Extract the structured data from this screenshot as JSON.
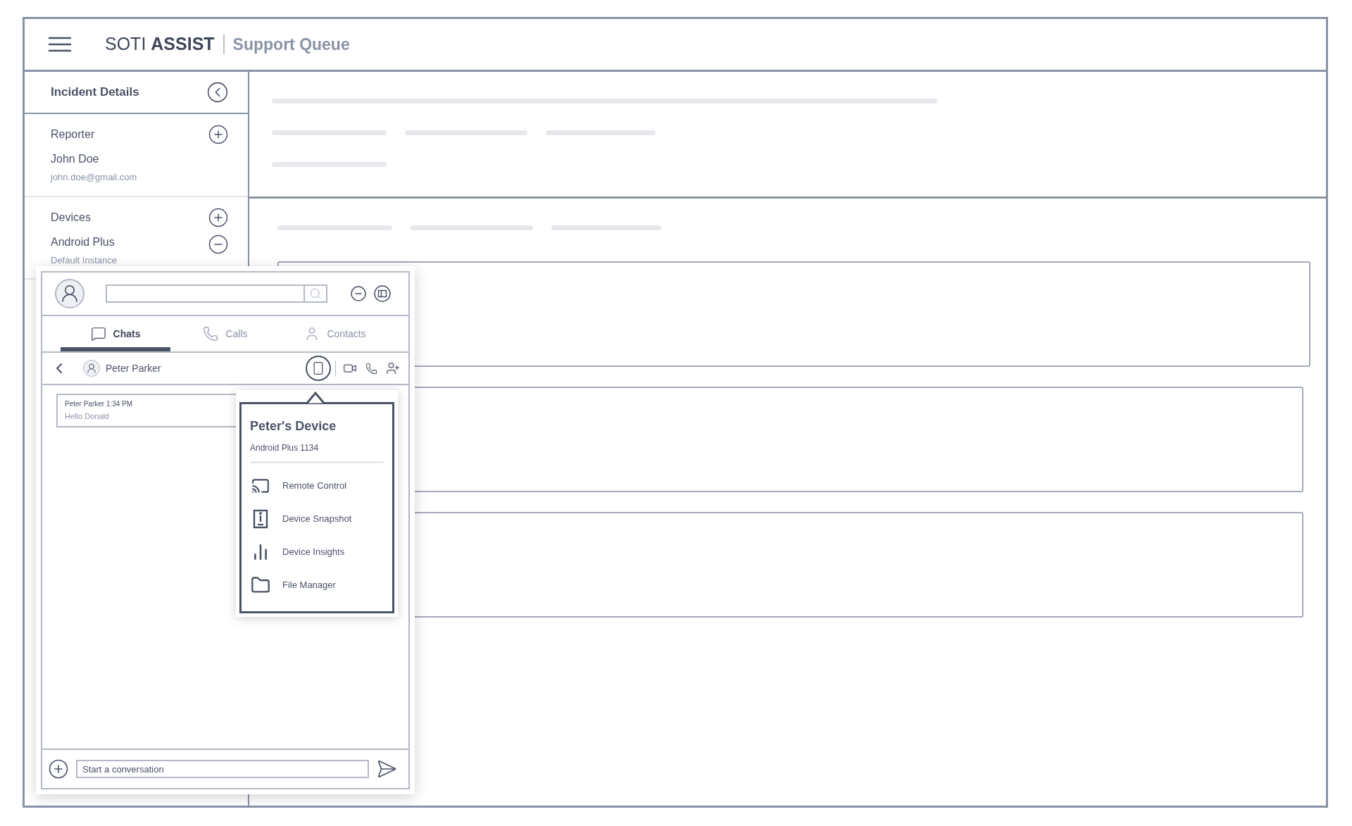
{
  "header": {
    "brand_light": "SOTI",
    "brand_bold": "ASSIST",
    "page_title": "Support Queue"
  },
  "sidebar": {
    "title": "Incident Details",
    "sections": [
      {
        "heading": "Reporter",
        "items": [
          {
            "title": "John Doe",
            "subtitle": "john.doe@gmail.com",
            "kind": "plain"
          }
        ]
      },
      {
        "heading": "Devices",
        "items": [
          {
            "title": "Android Plus",
            "subtitle": "Default Instance",
            "kind": "removable"
          }
        ]
      }
    ]
  },
  "chat": {
    "tabs": [
      {
        "label": "Chats",
        "kind": "chats",
        "selected": true
      },
      {
        "label": "Calls",
        "kind": "calls",
        "selected": false
      },
      {
        "label": "Contacts",
        "kind": "contacts",
        "selected": false
      }
    ],
    "contact": "Peter Parker",
    "messages": [
      {
        "meta": "Peter Parker 1:34 PM",
        "text": "Hello Donald"
      }
    ],
    "composer": {
      "placeholder": "Start a conversation"
    },
    "device_menu": {
      "title": "Peter's Device",
      "subtitle": "Android Plus 1134",
      "items": [
        {
          "label": "Remote Control",
          "kind": "remote"
        },
        {
          "label": "Device Snapshot",
          "kind": "snapshot"
        },
        {
          "label": "Device Insights",
          "kind": "insights"
        },
        {
          "label": "File Manager",
          "kind": "files"
        }
      ]
    }
  }
}
